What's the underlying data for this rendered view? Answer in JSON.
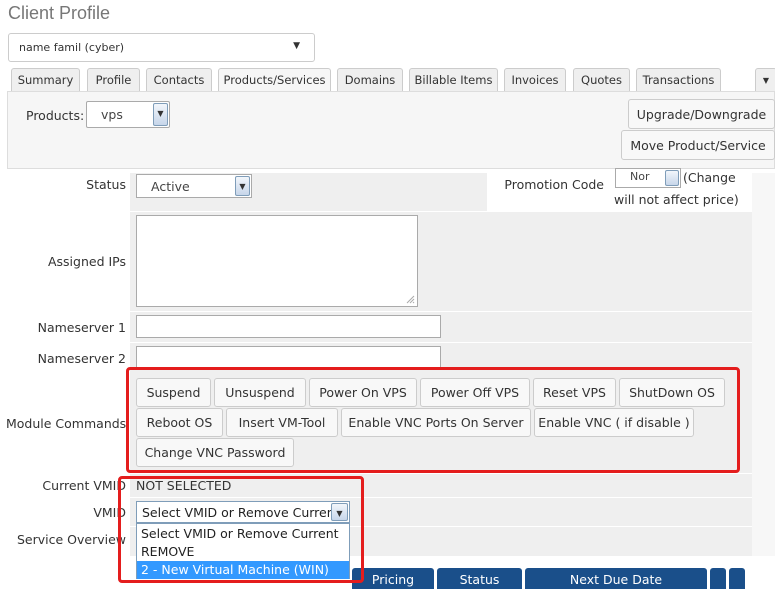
{
  "page": {
    "title": "Client Profile"
  },
  "client_selector": {
    "value": "name famil (cyber)"
  },
  "tabs": [
    {
      "label": "Summary"
    },
    {
      "label": "Profile"
    },
    {
      "label": "Contacts"
    },
    {
      "label": "Products/Services",
      "active": true
    },
    {
      "label": "Domains"
    },
    {
      "label": "Billable Items"
    },
    {
      "label": "Invoices"
    },
    {
      "label": "Quotes"
    },
    {
      "label": "Transactions"
    }
  ],
  "products": {
    "label": "Products:",
    "selected": "vps",
    "upgrade_button": "Upgrade/Downgrade",
    "move_button": "Move Product/Service"
  },
  "form": {
    "status_label": "Status",
    "status_value": "Active",
    "promotion_label": "Promotion Code",
    "promotion_value": "Nor",
    "promotion_note_line1": "(Change",
    "promotion_note_line2": "will not affect price)",
    "assigned_ips_label": "Assigned IPs",
    "ns1_label": "Nameserver 1",
    "ns2_label": "Nameserver 2",
    "module_commands_label": "Module Commands",
    "current_vmid_label": "Current VMID",
    "current_vmid_value": "NOT SELECTED",
    "vmid_label": "VMID",
    "vmid_selected": "Select VMID or Remove Current",
    "service_overview_label": "Service Overview"
  },
  "module_commands": [
    "Suspend",
    "Unsuspend",
    "Power On VPS",
    "Power Off VPS",
    "Reset VPS",
    "ShutDown OS",
    "Reboot OS",
    "Insert VM-Tool",
    "Enable VNC Ports On Server",
    "Enable VNC ( if disable )",
    "Change VNC Password"
  ],
  "vmid_options": [
    {
      "label": "Select VMID or Remove Current"
    },
    {
      "label": "REMOVE"
    },
    {
      "label": "2 - New Virtual Machine (WIN)",
      "highlighted": true
    }
  ],
  "table_headers": [
    "Pricing",
    "Status",
    "Next Due Date"
  ],
  "colors": {
    "highlight_box": "#e41d1d",
    "table_header": "#1a4f8a",
    "selection": "#3399ff"
  },
  "icons": {
    "dropdown": "chevron-down-icon",
    "resize": "resize-grip-icon"
  }
}
